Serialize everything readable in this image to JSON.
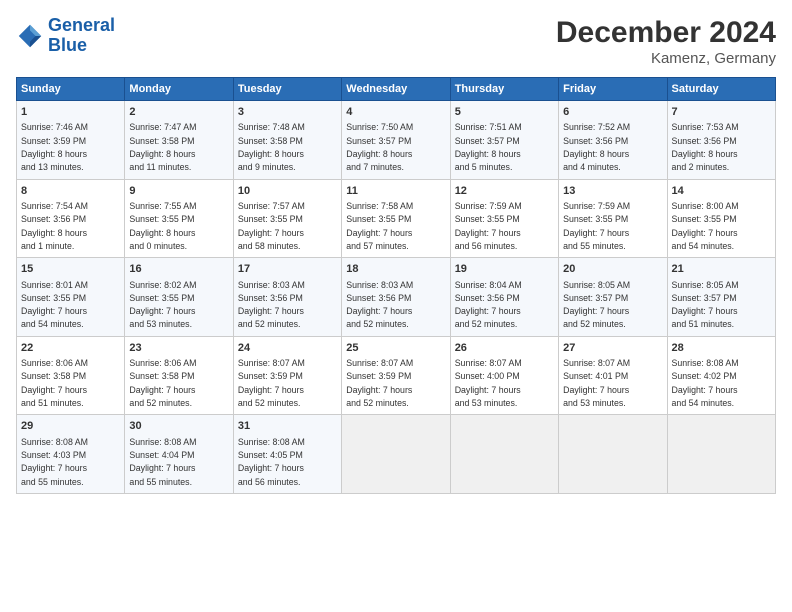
{
  "header": {
    "logo_line1": "General",
    "logo_line2": "Blue",
    "title": "December 2024",
    "location": "Kamenz, Germany"
  },
  "days_of_week": [
    "Sunday",
    "Monday",
    "Tuesday",
    "Wednesday",
    "Thursday",
    "Friday",
    "Saturday"
  ],
  "weeks": [
    [
      {
        "day": "1",
        "info": "Sunrise: 7:46 AM\nSunset: 3:59 PM\nDaylight: 8 hours\nand 13 minutes."
      },
      {
        "day": "2",
        "info": "Sunrise: 7:47 AM\nSunset: 3:58 PM\nDaylight: 8 hours\nand 11 minutes."
      },
      {
        "day": "3",
        "info": "Sunrise: 7:48 AM\nSunset: 3:58 PM\nDaylight: 8 hours\nand 9 minutes."
      },
      {
        "day": "4",
        "info": "Sunrise: 7:50 AM\nSunset: 3:57 PM\nDaylight: 8 hours\nand 7 minutes."
      },
      {
        "day": "5",
        "info": "Sunrise: 7:51 AM\nSunset: 3:57 PM\nDaylight: 8 hours\nand 5 minutes."
      },
      {
        "day": "6",
        "info": "Sunrise: 7:52 AM\nSunset: 3:56 PM\nDaylight: 8 hours\nand 4 minutes."
      },
      {
        "day": "7",
        "info": "Sunrise: 7:53 AM\nSunset: 3:56 PM\nDaylight: 8 hours\nand 2 minutes."
      }
    ],
    [
      {
        "day": "8",
        "info": "Sunrise: 7:54 AM\nSunset: 3:56 PM\nDaylight: 8 hours\nand 1 minute."
      },
      {
        "day": "9",
        "info": "Sunrise: 7:55 AM\nSunset: 3:55 PM\nDaylight: 8 hours\nand 0 minutes."
      },
      {
        "day": "10",
        "info": "Sunrise: 7:57 AM\nSunset: 3:55 PM\nDaylight: 7 hours\nand 58 minutes."
      },
      {
        "day": "11",
        "info": "Sunrise: 7:58 AM\nSunset: 3:55 PM\nDaylight: 7 hours\nand 57 minutes."
      },
      {
        "day": "12",
        "info": "Sunrise: 7:59 AM\nSunset: 3:55 PM\nDaylight: 7 hours\nand 56 minutes."
      },
      {
        "day": "13",
        "info": "Sunrise: 7:59 AM\nSunset: 3:55 PM\nDaylight: 7 hours\nand 55 minutes."
      },
      {
        "day": "14",
        "info": "Sunrise: 8:00 AM\nSunset: 3:55 PM\nDaylight: 7 hours\nand 54 minutes."
      }
    ],
    [
      {
        "day": "15",
        "info": "Sunrise: 8:01 AM\nSunset: 3:55 PM\nDaylight: 7 hours\nand 54 minutes."
      },
      {
        "day": "16",
        "info": "Sunrise: 8:02 AM\nSunset: 3:55 PM\nDaylight: 7 hours\nand 53 minutes."
      },
      {
        "day": "17",
        "info": "Sunrise: 8:03 AM\nSunset: 3:56 PM\nDaylight: 7 hours\nand 52 minutes."
      },
      {
        "day": "18",
        "info": "Sunrise: 8:03 AM\nSunset: 3:56 PM\nDaylight: 7 hours\nand 52 minutes."
      },
      {
        "day": "19",
        "info": "Sunrise: 8:04 AM\nSunset: 3:56 PM\nDaylight: 7 hours\nand 52 minutes."
      },
      {
        "day": "20",
        "info": "Sunrise: 8:05 AM\nSunset: 3:57 PM\nDaylight: 7 hours\nand 52 minutes."
      },
      {
        "day": "21",
        "info": "Sunrise: 8:05 AM\nSunset: 3:57 PM\nDaylight: 7 hours\nand 51 minutes."
      }
    ],
    [
      {
        "day": "22",
        "info": "Sunrise: 8:06 AM\nSunset: 3:58 PM\nDaylight: 7 hours\nand 51 minutes."
      },
      {
        "day": "23",
        "info": "Sunrise: 8:06 AM\nSunset: 3:58 PM\nDaylight: 7 hours\nand 52 minutes."
      },
      {
        "day": "24",
        "info": "Sunrise: 8:07 AM\nSunset: 3:59 PM\nDaylight: 7 hours\nand 52 minutes."
      },
      {
        "day": "25",
        "info": "Sunrise: 8:07 AM\nSunset: 3:59 PM\nDaylight: 7 hours\nand 52 minutes."
      },
      {
        "day": "26",
        "info": "Sunrise: 8:07 AM\nSunset: 4:00 PM\nDaylight: 7 hours\nand 53 minutes."
      },
      {
        "day": "27",
        "info": "Sunrise: 8:07 AM\nSunset: 4:01 PM\nDaylight: 7 hours\nand 53 minutes."
      },
      {
        "day": "28",
        "info": "Sunrise: 8:08 AM\nSunset: 4:02 PM\nDaylight: 7 hours\nand 54 minutes."
      }
    ],
    [
      {
        "day": "29",
        "info": "Sunrise: 8:08 AM\nSunset: 4:03 PM\nDaylight: 7 hours\nand 55 minutes."
      },
      {
        "day": "30",
        "info": "Sunrise: 8:08 AM\nSunset: 4:04 PM\nDaylight: 7 hours\nand 55 minutes."
      },
      {
        "day": "31",
        "info": "Sunrise: 8:08 AM\nSunset: 4:05 PM\nDaylight: 7 hours\nand 56 minutes."
      },
      null,
      null,
      null,
      null
    ]
  ]
}
